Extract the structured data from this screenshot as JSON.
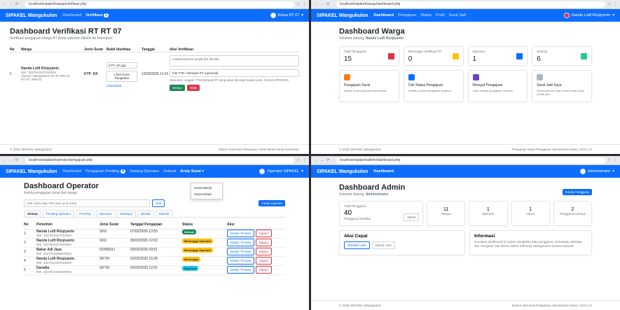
{
  "app_brand": "SIPAKEL Wangukulon",
  "p1": {
    "url": "localhost/sipakel/warga/verifikasi.php",
    "nav": [
      "Dashboard",
      "Verifikasi"
    ],
    "user": "Ketua RT 07",
    "title": "Dashboard Verifikasi RT RT 07",
    "subtitle": "Verifikasi pengajuan warga RT Anda sebelum dikirim ke kelurahan",
    "headers": [
      "No",
      "Warga",
      "Jenis Surat",
      "Bukti Identitas",
      "Tanggal",
      "Aksi Verifikasi"
    ],
    "row": {
      "no": "1",
      "name": "Nanda Lutfi Rizqiyanto",
      "nik": "NIK: 3317010107010004",
      "addr": "Alamat: Wangukulon RT 07 RW 03",
      "rtrw": "RT 07 / RW 03",
      "jenis": "KTP_KK",
      "id_file": "KTP_KK.jpg",
      "id_label": "Lihat Surat Pengantar",
      "id_link": "Lihat Bukti",
      "tanggal": "12/02/2026 11:41",
      "note_placeholder": "Catatan/alasan (wajib jika ditolak)",
      "stamp_label": "File TTD / Stempel RT (opsional)",
      "stamp_help": "Opsional: unggah TTD/stempel RT yang akan ditempel pada surat. Format JPG/PNG.",
      "approve": "Setujui",
      "reject": "Tolak"
    },
    "footer_left": "© 2026 SIPAKEL Wangukulon",
    "footer_right": "Sistem Informasi Pelayanan Administrasi Desa Kelurahan"
  },
  "p2": {
    "url": "localhost/sipakel/warga/dashboard.php",
    "nav": [
      "Dashboard",
      "Pengajuan",
      "Status",
      "Profil",
      "Surat Jadi"
    ],
    "user": "Nanda Lutfi Rizqiyanto",
    "title": "Dashboard Warga",
    "subtitle_prefix": "Selamat datang, ",
    "subtitle_name": "Nanda Lutfi Rizqiyanto",
    "stats": [
      {
        "label": "Total Pengajuan",
        "value": "15",
        "color": "#dc3545"
      },
      {
        "label": "Menunggu Verifikasi RT",
        "value": "0",
        "color": "#ffc107"
      },
      {
        "label": "Diproses",
        "value": "1",
        "color": "#0d6efd"
      },
      {
        "label": "Selesai",
        "value": "6",
        "color": "#20c997"
      }
    ],
    "menus": [
      {
        "title": "Pengajuan Surat",
        "desc": "Ajukan surat yang kamu butuhkan",
        "color": "#fd7e14"
      },
      {
        "title": "Cek Status Pengajuan",
        "desc": "Pantau proses pengajuan suratmu",
        "color": "#0d6efd"
      },
      {
        "title": "Riwayat Pengajuan",
        "desc": "Lihat riwayat pengajuan suratmu",
        "color": "#6f42c1"
      },
      {
        "title": "Surat Jadi Saya",
        "desc": "Download dan lihat semua surat yang sudah jadi",
        "color": "#adb5bd"
      }
    ],
    "footer_left": "© 2026 SIPAKEL Wangukulon",
    "footer_right": "Pelayanan Surat Pengajuan Administrasi Desa | Versi 1.0"
  },
  "p3": {
    "url": "localhost/sipakel/operator/pengajuan.php",
    "nav": [
      "Dashboard",
      "Pengajuan Pending",
      "Sedang Diproses",
      "Selesai",
      "Arsip Surat"
    ],
    "pending_count": "4",
    "user": "Operator SIPAKEL",
    "title": "Dashboard Operator",
    "subtitle": "Kelola pengajuan surat dari warga",
    "search_placeholder": "Cari nama atau NIK atau jenis surat",
    "search_btn": "Cari",
    "export_btn": "Cetak Laporan",
    "dropdown": [
      "Surat Masuk",
      "Surat Keluar"
    ],
    "tabs": [
      "Semua",
      "Pending Operator",
      "Pending",
      "Diproses",
      "Disetujui",
      "Ditolak",
      "Selesai"
    ],
    "headers": [
      "No",
      "Pemohon",
      "Jenis Surat",
      "Tanggal Pengajuan",
      "Status",
      "Aksi"
    ],
    "rows": [
      {
        "no": "1",
        "name": "Nanda Lutfi Rizqiyanto",
        "nik": "NIK: 3317010107010004",
        "jenis": "SKU",
        "tgl": "07/02/2026 13:55",
        "status": "Selesai",
        "st": "st-green"
      },
      {
        "no": "2",
        "name": "Nanda Lutfi Rizqiyanto",
        "nik": "NIK: 3317010107010004",
        "jenis": "SKU",
        "tgl": "05/02/2026 12:02",
        "status": "Menunggu Operator",
        "st": "st-yellow"
      },
      {
        "no": "3",
        "name": "Bahar Adi Jaya",
        "nik": "NIK: 3317010206870002",
        "jenis": "DOMISILI",
        "tgl": "03/02/2026 09:51",
        "status": "Menunggu Operator",
        "st": "st-yellow"
      },
      {
        "no": "4",
        "name": "Nanda Lutfi Rizqiyanto",
        "nik": "NIK: 3317010107010004",
        "jenis": "SKTM",
        "tgl": "02/02/2026 15:28",
        "status": "Menunggu",
        "st": "st-yellow"
      },
      {
        "no": "5",
        "name": "Daradia",
        "nik": "NIK: 3317010202020002",
        "jenis": "SKTM",
        "tgl": "02/02/2026 12:01",
        "status": "Diproses",
        "st": "st-blue"
      }
    ],
    "act_detail": "Detail / Proses",
    "act_del": "Hapus"
  },
  "p4": {
    "url": "localhost/sipakel/admin/dashboard.php",
    "nav": [
      "Dashboard"
    ],
    "user": "Administrator",
    "title": "Dashboard Admin",
    "subtitle_prefix": "Selamat datang, ",
    "subtitle_name": "Administrator",
    "add_btn": "Kelola Pengguna",
    "total_label": "Total Pengguna",
    "total_value": "40",
    "total_note": "Pengguna terdaftar",
    "detail_btn": "Detail",
    "counts": [
      {
        "value": "11",
        "label": "Warga"
      },
      {
        "value": "1",
        "label": "Operator"
      },
      {
        "value": "1",
        "label": "Admin"
      },
      {
        "value": "2",
        "label": "Pengguna Lainnya"
      }
    ],
    "quick_title": "Aksi Cepat",
    "quick_btns": [
      "Tambah User",
      "Kelola User"
    ],
    "info_title": "Informasi",
    "info_text": "Gunakan dashboard ini untuk mengelola data pengguna, memantau aktivitas, dan mengatur hak akses sistem SIPAKEL Wangukulon secara terpusat.",
    "footer_left": "© 2026 SIPAKEL Wangukulon",
    "footer_right": "Sistem Informasi Pelayanan Administrasi Desa | Versi 1.0"
  }
}
